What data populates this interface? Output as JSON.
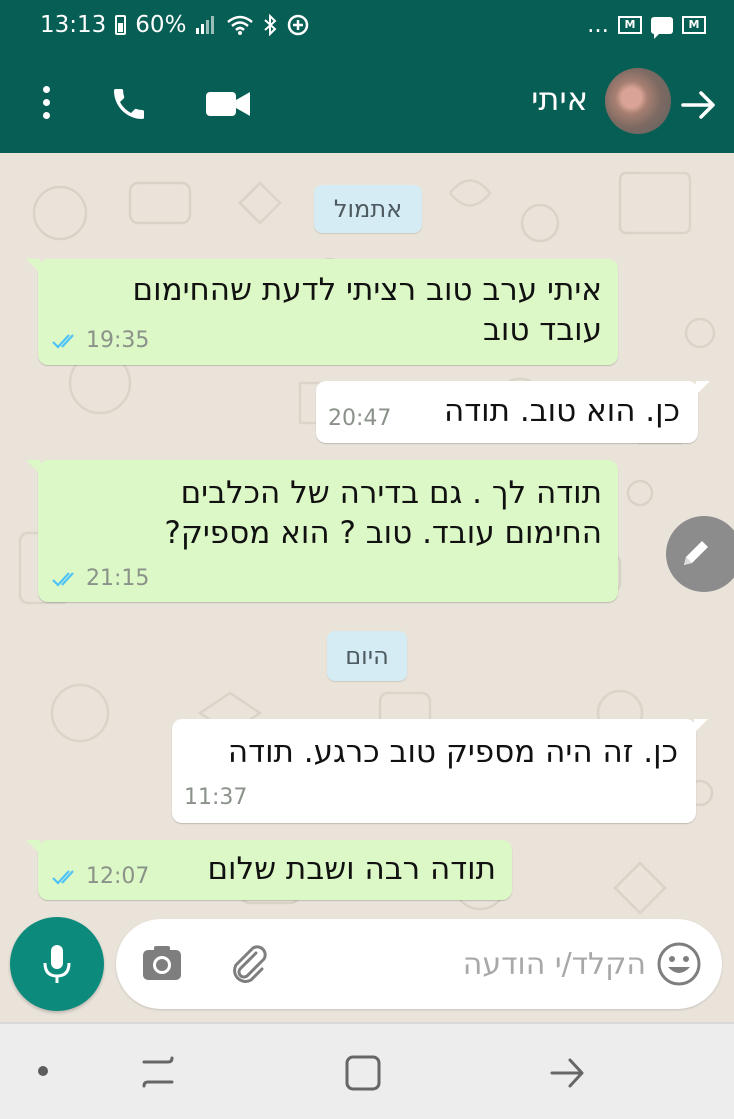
{
  "status_bar": {
    "time": "13:13",
    "battery": "60%",
    "more": "...",
    "mail_icon_letter": "M"
  },
  "header": {
    "contact_name": "איתי"
  },
  "chat": {
    "date_separators": [
      "אתמול",
      "היום"
    ],
    "messages": [
      {
        "direction": "outgoing",
        "lines": [
          "איתי ערב טוב רציתי לדעת שהחימום",
          "עובד טוב"
        ],
        "time": "19:35",
        "status": "read"
      },
      {
        "direction": "incoming",
        "lines": [
          "כן. הוא טוב. תודה"
        ],
        "time": "20:47"
      },
      {
        "direction": "outgoing",
        "lines": [
          "תודה לך . גם בדירה של הכלבים",
          "החימום עובד. טוב ? הוא מספיק?"
        ],
        "time": "21:15",
        "status": "read"
      },
      {
        "direction": "incoming",
        "lines": [
          "כן. זה היה מספיק טוב כרגע. תודה"
        ],
        "time": "11:37"
      },
      {
        "direction": "outgoing",
        "lines": [
          "תודה רבה ושבת שלום"
        ],
        "time": "12:07",
        "status": "read"
      }
    ]
  },
  "composer": {
    "placeholder": "הקלד/י הודעה"
  },
  "colors": {
    "header": "#075e54",
    "outgoing_bubble": "#dcf8c6",
    "incoming_bubble": "#ffffff",
    "read_ticks": "#4fc3f7",
    "mic_button": "#0c8a7c"
  },
  "icons": [
    "battery-icon",
    "signal-icon",
    "wifi-icon",
    "bluetooth-icon",
    "data-saver-icon",
    "mail-icon",
    "chat-notification-icon",
    "menu-dots-icon",
    "phone-icon",
    "video-camera-icon",
    "back-arrow-icon",
    "pencil-icon",
    "mic-icon",
    "camera-icon",
    "paperclip-icon",
    "emoji-icon",
    "recent-apps-icon",
    "home-icon",
    "system-back-icon"
  ]
}
